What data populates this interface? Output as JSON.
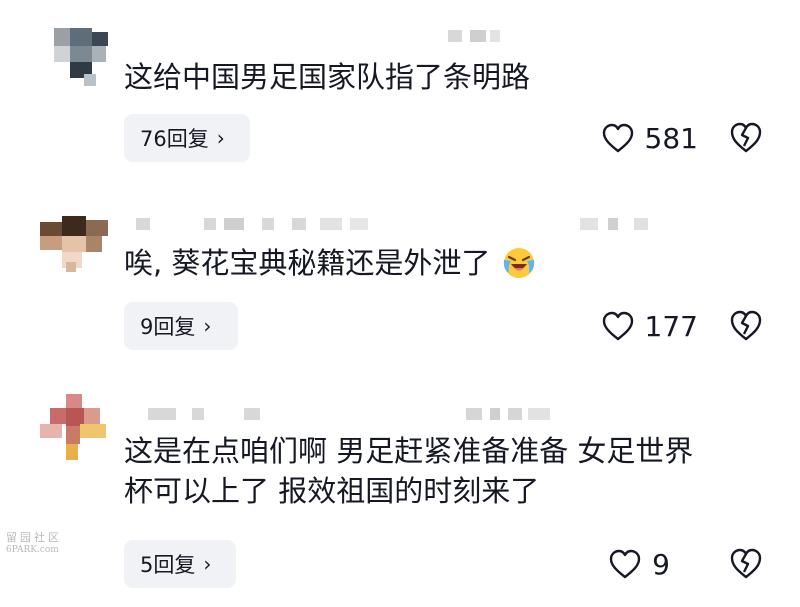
{
  "comments": [
    {
      "text": "这给中国男足国家队指了条明路",
      "reply_label": "76回复",
      "likes": "581"
    },
    {
      "text": "唉, 葵花宝典秘籍还是外泄了",
      "reply_label": "9回复",
      "likes": "177",
      "emoji": "laughing-crying-emoji"
    },
    {
      "text_line1": "这是在点咱们啊 男足赶紧准备准备 女足世界",
      "text_line2": "杯可以上了 报效祖国的时刻来了",
      "reply_label": "5回复",
      "likes": "9"
    }
  ],
  "chevron": "›",
  "icons": {
    "like": "heart-outline-icon",
    "dislike": "broken-heart-icon"
  },
  "watermark": {
    "line1": "留园社区",
    "line2": "6PARK.com"
  },
  "colors": {
    "text": "#161823",
    "pill_bg": "#f1f2f5",
    "blur_gray": "#d8d8d8"
  }
}
